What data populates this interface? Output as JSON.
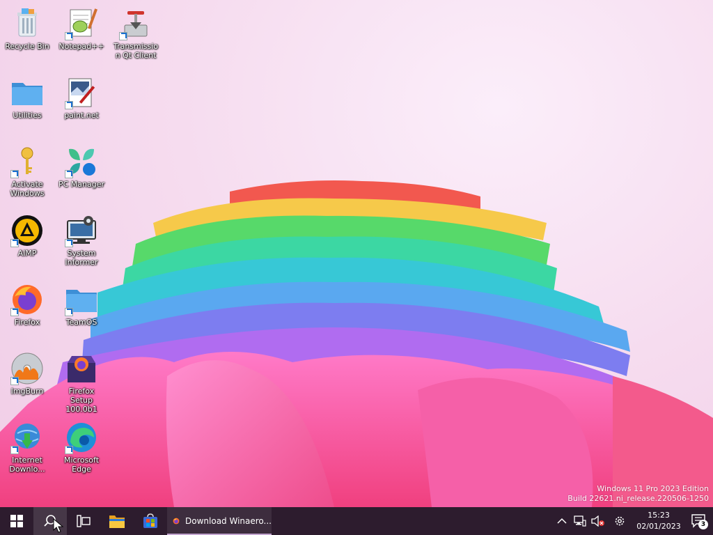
{
  "desktop": {
    "icons": [
      {
        "label": "Recycle Bin",
        "icon": "recycle-bin-icon"
      },
      {
        "label": "Notepad++",
        "icon": "notepad-plus-plus-icon"
      },
      {
        "label": "Transmission Qt Client",
        "icon": "transmission-icon"
      },
      {
        "label": "Utilities",
        "icon": "folder-icon"
      },
      {
        "label": "paint.net",
        "icon": "paint-net-icon"
      },
      {
        "label": "Activate Windows",
        "icon": "key-icon"
      },
      {
        "label": "PC Manager",
        "icon": "pc-manager-icon"
      },
      {
        "label": "AIMP",
        "icon": "aimp-icon"
      },
      {
        "label": "System Informer",
        "icon": "system-informer-icon"
      },
      {
        "label": "Firefox",
        "icon": "firefox-icon"
      },
      {
        "label": "TeamOS",
        "icon": "folder-icon"
      },
      {
        "label": "ImgBurn",
        "icon": "imgburn-icon"
      },
      {
        "label": "Firefox Setup 100.0b1",
        "icon": "firefox-setup-icon"
      },
      {
        "label": "Internet Downlo...",
        "icon": "internet-download-manager-icon"
      },
      {
        "label": "Microsoft Edge",
        "icon": "edge-icon"
      }
    ]
  },
  "watermark": {
    "line1": "Windows 11 Pro 2023 Edition",
    "line2": "Build 22621.ni_release.220506-1250"
  },
  "taskbar": {
    "buttons": [
      "start-icon",
      "search-icon",
      "task-view-icon",
      "file-explorer-icon",
      "store-icon"
    ],
    "running_app": {
      "label": "Download Winaero...",
      "icon": "firefox-icon"
    },
    "tray": {
      "icons": [
        "chevron-up-icon",
        "network-icon",
        "volume-muted-icon",
        "settings-icon"
      ],
      "time": "15:23",
      "date": "02/01/2023",
      "notification_count": "3"
    }
  },
  "colors": {
    "taskbar": "#2d1c2e",
    "folder": "#4aa3ea",
    "accent": "#1a6fd0"
  }
}
